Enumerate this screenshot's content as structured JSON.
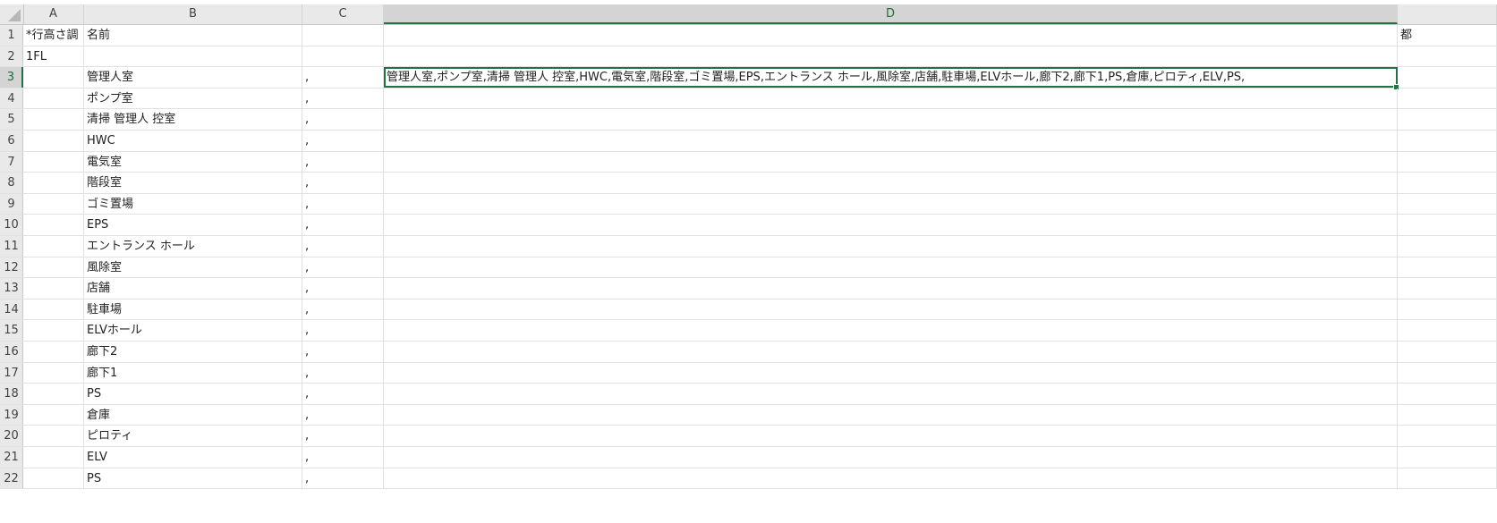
{
  "columns": [
    {
      "label": "A",
      "selected": false
    },
    {
      "label": "B",
      "selected": false
    },
    {
      "label": "C",
      "selected": false
    },
    {
      "label": "D",
      "selected": true
    },
    {
      "label": "",
      "selected": false
    }
  ],
  "rows": [
    {
      "num": "1",
      "A": "*行高さ調",
      "B": "名前",
      "C": "",
      "D": "",
      "E": "都"
    },
    {
      "num": "2",
      "A": "1FL",
      "B": "",
      "C": "",
      "D": "",
      "E": ""
    },
    {
      "num": "3",
      "A": "",
      "B": "管理人室",
      "C": ",",
      "D": "管理人室,ポンプ室,清掃 管理人 控室,HWC,電気室,階段室,ゴミ置場,EPS,エントランス ホール,風除室,店舗,駐車場,ELVホール,廊下2,廊下1,PS,倉庫,ピロティ,ELV,PS,",
      "E": "",
      "selected": true
    },
    {
      "num": "4",
      "A": "",
      "B": "ポンプ室",
      "C": ",",
      "D": "",
      "E": ""
    },
    {
      "num": "5",
      "A": "",
      "B": "清掃 管理人 控室",
      "C": ",",
      "D": "",
      "E": ""
    },
    {
      "num": "6",
      "A": "",
      "B": "HWC",
      "C": ",",
      "D": "",
      "E": ""
    },
    {
      "num": "7",
      "A": "",
      "B": "電気室",
      "C": ",",
      "D": "",
      "E": ""
    },
    {
      "num": "8",
      "A": "",
      "B": "階段室",
      "C": ",",
      "D": "",
      "E": ""
    },
    {
      "num": "9",
      "A": "",
      "B": "ゴミ置場",
      "C": ",",
      "D": "",
      "E": ""
    },
    {
      "num": "10",
      "A": "",
      "B": "EPS",
      "C": ",",
      "D": "",
      "E": ""
    },
    {
      "num": "11",
      "A": "",
      "B": "エントランス ホール",
      "C": ",",
      "D": "",
      "E": ""
    },
    {
      "num": "12",
      "A": "",
      "B": "風除室",
      "C": ",",
      "D": "",
      "E": ""
    },
    {
      "num": "13",
      "A": "",
      "B": "店舗",
      "C": ",",
      "D": "",
      "E": ""
    },
    {
      "num": "14",
      "A": "",
      "B": "駐車場",
      "C": ",",
      "D": "",
      "E": ""
    },
    {
      "num": "15",
      "A": "",
      "B": "ELVホール",
      "C": ",",
      "D": "",
      "E": ""
    },
    {
      "num": "16",
      "A": "",
      "B": "廊下2",
      "C": ",",
      "D": "",
      "E": ""
    },
    {
      "num": "17",
      "A": "",
      "B": "廊下1",
      "C": ",",
      "D": "",
      "E": ""
    },
    {
      "num": "18",
      "A": "",
      "B": "PS",
      "C": ",",
      "D": "",
      "E": ""
    },
    {
      "num": "19",
      "A": "",
      "B": "倉庫",
      "C": ",",
      "D": "",
      "E": ""
    },
    {
      "num": "20",
      "A": "",
      "B": "ピロティ",
      "C": ",",
      "D": "",
      "E": ""
    },
    {
      "num": "21",
      "A": "",
      "B": "ELV",
      "C": ",",
      "D": "",
      "E": ""
    },
    {
      "num": "22",
      "A": "",
      "B": "PS",
      "C": ",",
      "D": "",
      "E": ""
    }
  ]
}
